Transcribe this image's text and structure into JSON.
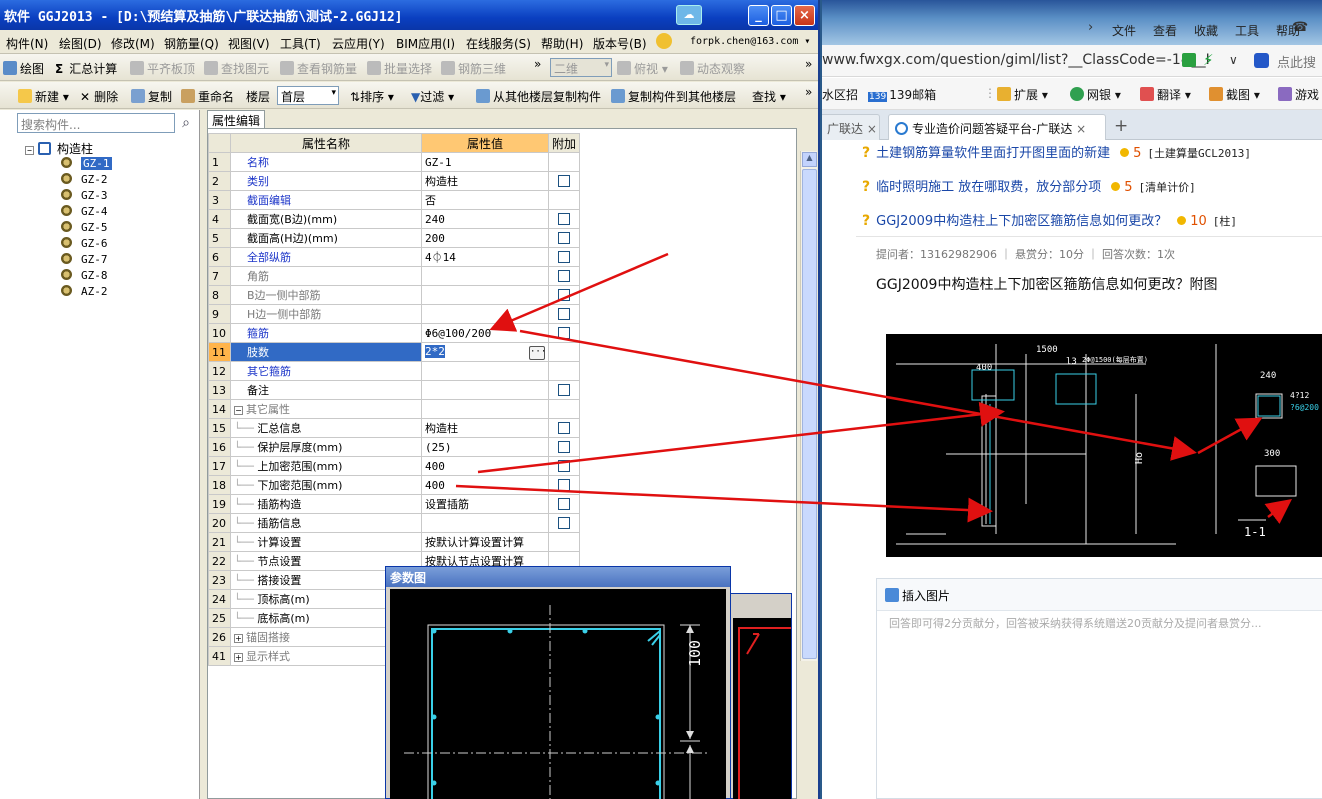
{
  "app": {
    "title": "软件 GGJ2013 - [D:\\预结算及抽筋\\广联达抽筋\\测试-2.GGJ12]",
    "title_icon": "☁",
    "menu": [
      "构件(N)",
      "绘图(D)",
      "修改(M)",
      "钢筋量(Q)",
      "视图(V)",
      "工具(T)",
      "云应用(Y)",
      "BIM应用(I)",
      "在线服务(S)",
      "帮助(H)",
      "版本号(B)"
    ],
    "user_email": "forpk.chen@163.com ▾",
    "toolbar1": {
      "draw": "绘图",
      "sum": "汇总计算",
      "flat": "平齐板顶",
      "find_elem": "查找图元",
      "view_rebar": "查看钢筋量",
      "batch_select": "批量选择",
      "rebar_3d": "钢筋三维",
      "view_2d": "二维",
      "top_view": "俯视",
      "dynamic": "动态观察"
    },
    "toolbar2": {
      "new": "新建",
      "delete": "删除",
      "copy": "复制",
      "rename": "重命名",
      "floor_label": "楼层",
      "floor_value": "首层",
      "sort": "排序",
      "filter": "过滤",
      "copy_from": "从其他楼层复制构件",
      "copy_to": "复制构件到其他楼层",
      "find": "查找"
    },
    "search_placeholder": "搜索构件...",
    "tree": {
      "root": "构造柱",
      "items": [
        "GZ-1",
        "GZ-2",
        "GZ-3",
        "GZ-4",
        "GZ-5",
        "GZ-6",
        "GZ-7",
        "GZ-8",
        "AZ-2"
      ]
    },
    "prop_tab": "属性编辑",
    "grid_headers": {
      "name": "属性名称",
      "value": "属性值",
      "extra": "附加"
    },
    "rows": [
      {
        "n": "1",
        "name": "名称",
        "val": "GZ-1",
        "style": "blue",
        "cb": false
      },
      {
        "n": "2",
        "name": "类别",
        "val": "构造柱",
        "style": "blue",
        "cb": true
      },
      {
        "n": "3",
        "name": "截面编辑",
        "val": "否",
        "style": "blue",
        "cb": false
      },
      {
        "n": "4",
        "name": "截面宽(B边)(mm)",
        "val": "240",
        "style": "",
        "cb": true
      },
      {
        "n": "5",
        "name": "截面高(H边)(mm)",
        "val": "200",
        "style": "",
        "cb": true
      },
      {
        "n": "6",
        "name": "全部纵筋",
        "val": "4⏀14",
        "style": "blue",
        "cb": true
      },
      {
        "n": "7",
        "name": "角筋",
        "val": "",
        "style": "gray",
        "cb": true
      },
      {
        "n": "8",
        "name": "B边一侧中部筋",
        "val": "",
        "style": "gray",
        "cb": true
      },
      {
        "n": "9",
        "name": "H边一侧中部筋",
        "val": "",
        "style": "gray",
        "cb": true
      },
      {
        "n": "10",
        "name": "箍筋",
        "val": "Φ6@100/200",
        "style": "blue",
        "cb": true
      },
      {
        "n": "11",
        "name": "肢数",
        "val": "2*2",
        "style": "sel",
        "cb": false
      },
      {
        "n": "12",
        "name": "其它箍筋",
        "val": "",
        "style": "blue",
        "cb": false
      },
      {
        "n": "13",
        "name": "备注",
        "val": "",
        "style": "",
        "cb": true
      },
      {
        "n": "14",
        "name": "其它属性",
        "val": "",
        "style": "group",
        "cb": false
      },
      {
        "n": "15",
        "name": "汇总信息",
        "val": "构造柱",
        "style": "child",
        "cb": true
      },
      {
        "n": "16",
        "name": "保护层厚度(mm)",
        "val": "(25)",
        "style": "child",
        "cb": true
      },
      {
        "n": "17",
        "name": "上加密范围(mm)",
        "val": "400",
        "style": "child",
        "cb": true
      },
      {
        "n": "18",
        "name": "下加密范围(mm)",
        "val": "400",
        "style": "child",
        "cb": true
      },
      {
        "n": "19",
        "name": "插筋构造",
        "val": "设置插筋",
        "style": "child",
        "cb": true
      },
      {
        "n": "20",
        "name": "插筋信息",
        "val": "",
        "style": "child",
        "cb": true
      },
      {
        "n": "21",
        "name": "计算设置",
        "val": "按默认计算设置计算",
        "style": "child",
        "cb": false
      },
      {
        "n": "22",
        "name": "节点设置",
        "val": "按默认节点设置计算",
        "style": "child",
        "cb": false
      },
      {
        "n": "23",
        "name": "搭接设置",
        "val": "",
        "style": "child",
        "cb": false
      },
      {
        "n": "24",
        "name": "顶标高(m)",
        "val": "",
        "style": "child",
        "cb": false
      },
      {
        "n": "25",
        "name": "底标高(m)",
        "val": "",
        "style": "child",
        "cb": false
      },
      {
        "n": "26",
        "name": "锚固搭接",
        "val": "",
        "style": "collapsed",
        "cb": false
      },
      {
        "n": "41",
        "name": "显示样式",
        "val": "",
        "style": "collapsed",
        "cb": false
      }
    ],
    "param_title": "参数图",
    "param_dim": "100"
  },
  "browser": {
    "menu": [
      "文件",
      "查看",
      "收藏",
      "工具",
      "帮助"
    ],
    "url": "www.fwxgx.com/question/giml/list?__ClassCode=-1&__I",
    "url_hint": "点此搜",
    "bookmarks": [
      "水区招",
      "139邮箱",
      "扩展",
      "网银",
      "翻译",
      "截图",
      "游戏"
    ],
    "bookmark_139_prefix": "139",
    "tabs": [
      {
        "label": "广联达",
        "active": false
      },
      {
        "label": "专业造价问题答疑平台-广联达",
        "active": true
      }
    ],
    "questions": [
      {
        "title": "土建钢筋算量软件里面打开图里面的新建",
        "points": "5",
        "tag": "[土建算量GCL2013]"
      },
      {
        "title": "临时照明施工 放在哪取费，放分部分项",
        "points": "5",
        "tag": "[清单计价]"
      },
      {
        "title": "GGJ2009中构造柱上下加密区箍筋信息如何更改？",
        "points": "10",
        "tag": "[柱]"
      }
    ],
    "detail": {
      "meta": "提问者：13162982906  ｜  悬赏分：10分  ｜  回答次数：1次",
      "title": "GGJ2009中构造柱上下加密区箍筋信息如何更改？附图"
    },
    "answer": {
      "insert_image": "插入图片",
      "placeholder": "回答即可得2分贡献分，回答被采纳获得系统赠送20贡献分及提问者悬赏分..."
    },
    "drawing_labels": {
      "dim_1500": "1500",
      "dim_400": "400",
      "dim_l3": "l3",
      "dim_240": "240",
      "dim_300": "300",
      "note_top": "2Φ@1500(每层布置)",
      "h_label": "Ho",
      "section": "1-1",
      "bar1": "4?12",
      "bar2": "?6@200"
    }
  },
  "colors": {
    "accent": "#316ac5",
    "arrow": "#e01010",
    "link": "#1a47a8"
  }
}
